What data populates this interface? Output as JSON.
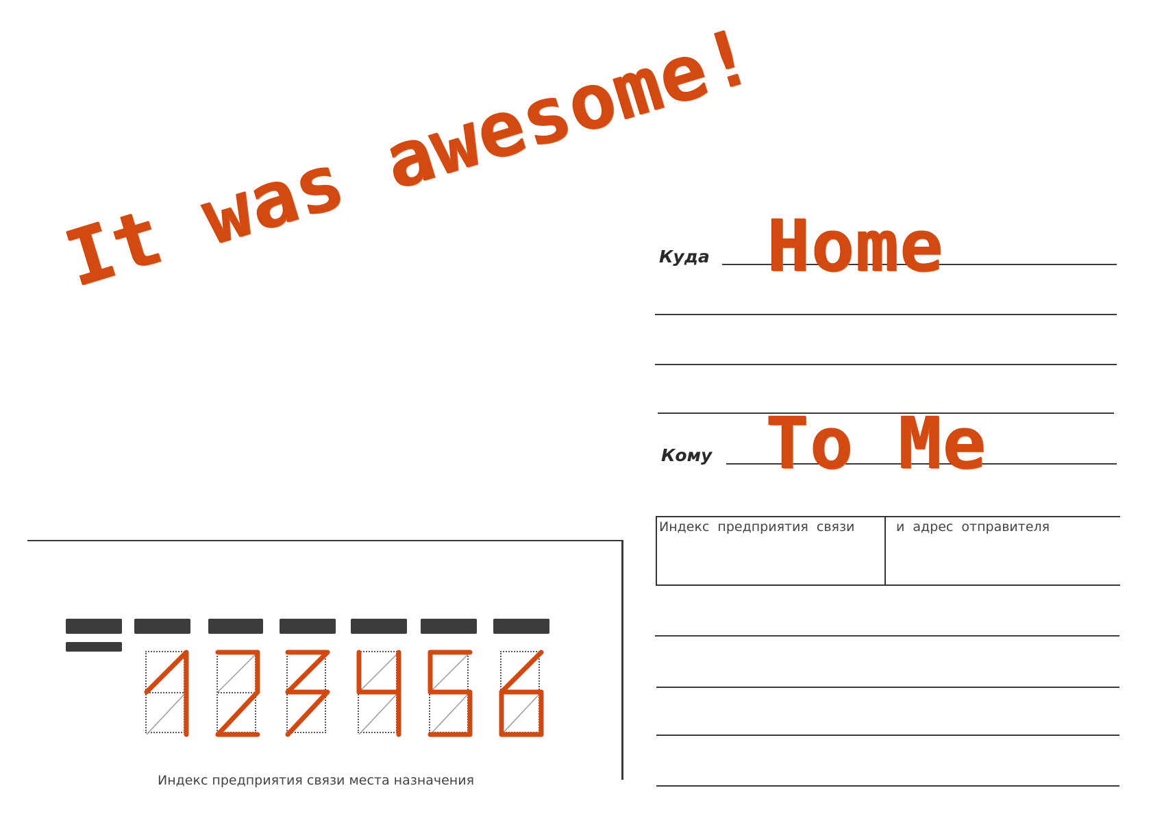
{
  "message": {
    "text": "It was awesome!"
  },
  "address": {
    "to_where_label": "Куда",
    "to_where_value": "Home",
    "to_whom_label": "Кому",
    "to_whom_value": "To Me"
  },
  "sender": {
    "index_label": "Индекс предприятия связи",
    "address_label": "и адрес отправителя"
  },
  "postcode": {
    "digits": [
      "1",
      "2",
      "3",
      "4",
      "5",
      "6"
    ],
    "caption": "Индекс предприятия связи места назначения"
  },
  "colors": {
    "ink": "#d24a12",
    "print": "#3a3a3a"
  }
}
